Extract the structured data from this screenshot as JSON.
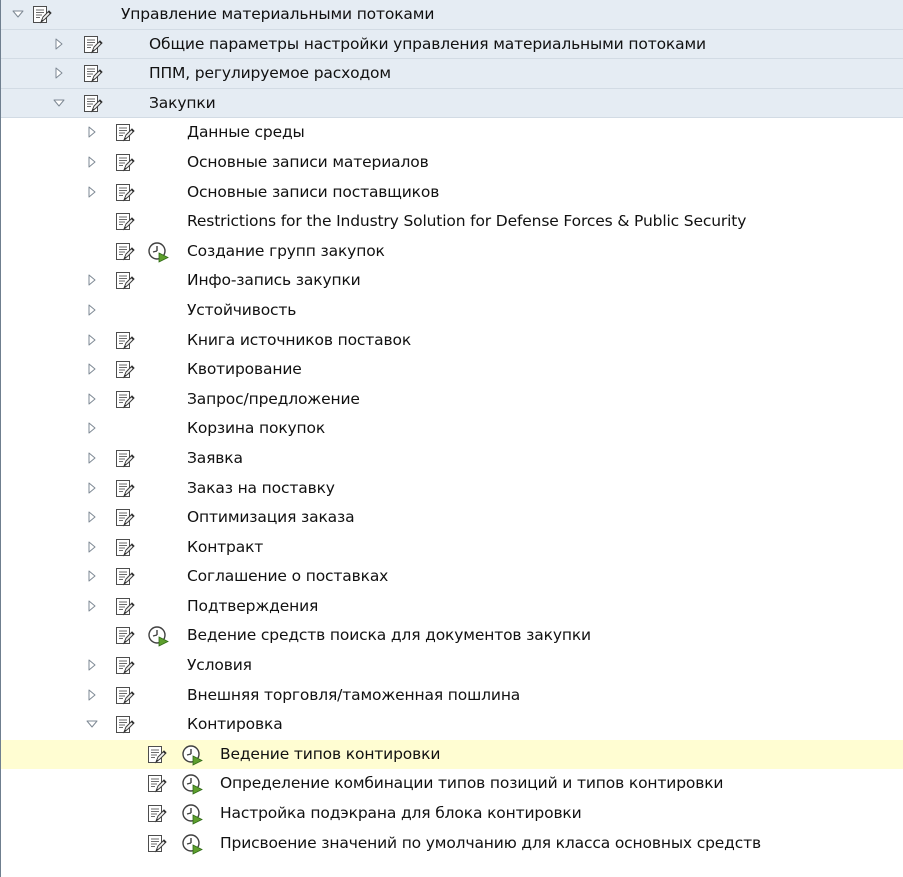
{
  "tree": {
    "items": [
      {
        "label": "Управление материальными потоками",
        "expander": "expanded",
        "doc": true,
        "exec": false,
        "bg": "bg",
        "level": 0
      },
      {
        "label": "Общие параметры настройки управления материальными потоками",
        "expander": "collapsed",
        "doc": true,
        "exec": false,
        "bg": "bg",
        "level": 1
      },
      {
        "label": "ППМ, регулируемое расходом",
        "expander": "collapsed",
        "doc": true,
        "exec": false,
        "bg": "bg",
        "level": 1
      },
      {
        "label": "Закупки",
        "expander": "expanded",
        "doc": true,
        "exec": false,
        "bg": "bg",
        "level": 1
      },
      {
        "label": "Данные среды",
        "expander": "collapsed",
        "doc": true,
        "exec": false,
        "bg": "white",
        "level": 2
      },
      {
        "label": "Основные записи материалов",
        "expander": "collapsed",
        "doc": true,
        "exec": false,
        "bg": "white",
        "level": 2
      },
      {
        "label": "Основные записи поставщиков",
        "expander": "collapsed",
        "doc": true,
        "exec": false,
        "bg": "white",
        "level": 2
      },
      {
        "label": "Restrictions for the Industry Solution for Defense Forces & Public Security",
        "expander": "none",
        "doc": true,
        "exec": false,
        "bg": "white",
        "level": 2
      },
      {
        "label": "Создание групп закупок",
        "expander": "none",
        "doc": true,
        "exec": true,
        "bg": "white",
        "level": 2
      },
      {
        "label": "Инфо-запись закупки",
        "expander": "collapsed",
        "doc": true,
        "exec": false,
        "bg": "white",
        "level": 2
      },
      {
        "label": "Устойчивость",
        "expander": "collapsed",
        "doc": false,
        "exec": false,
        "bg": "white",
        "level": 2
      },
      {
        "label": "Книга источников поставок",
        "expander": "collapsed",
        "doc": true,
        "exec": false,
        "bg": "white",
        "level": 2
      },
      {
        "label": "Квотирование",
        "expander": "collapsed",
        "doc": true,
        "exec": false,
        "bg": "white",
        "level": 2
      },
      {
        "label": "Запрос/предложение",
        "expander": "collapsed",
        "doc": true,
        "exec": false,
        "bg": "white",
        "level": 2
      },
      {
        "label": "Корзина покупок",
        "expander": "collapsed",
        "doc": false,
        "exec": false,
        "bg": "white",
        "level": 2
      },
      {
        "label": "Заявка",
        "expander": "collapsed",
        "doc": true,
        "exec": false,
        "bg": "white",
        "level": 2
      },
      {
        "label": "Заказ на поставку",
        "expander": "collapsed",
        "doc": true,
        "exec": false,
        "bg": "white",
        "level": 2
      },
      {
        "label": "Оптимизация заказа",
        "expander": "collapsed",
        "doc": true,
        "exec": false,
        "bg": "white",
        "level": 2
      },
      {
        "label": "Контракт",
        "expander": "collapsed",
        "doc": true,
        "exec": false,
        "bg": "white",
        "level": 2
      },
      {
        "label": "Соглашение о поставках",
        "expander": "collapsed",
        "doc": true,
        "exec": false,
        "bg": "white",
        "level": 2
      },
      {
        "label": "Подтверждения",
        "expander": "collapsed",
        "doc": true,
        "exec": false,
        "bg": "white",
        "level": 2
      },
      {
        "label": "Ведение средств поиска для документов закупки",
        "expander": "none",
        "doc": true,
        "exec": true,
        "bg": "white",
        "level": 2
      },
      {
        "label": "Условия",
        "expander": "collapsed",
        "doc": true,
        "exec": false,
        "bg": "white",
        "level": 2
      },
      {
        "label": "Внешняя торговля/таможенная пошлина",
        "expander": "collapsed",
        "doc": true,
        "exec": false,
        "bg": "white",
        "level": 2
      },
      {
        "label": "Контировка",
        "expander": "expanded",
        "doc": true,
        "exec": false,
        "bg": "white",
        "level": 2
      },
      {
        "label": "Ведение типов контировки",
        "expander": "none",
        "doc": true,
        "exec": true,
        "bg": "selected",
        "level": 3
      },
      {
        "label": "Определение комбинации типов позиций и типов контировки",
        "expander": "none",
        "doc": true,
        "exec": true,
        "bg": "white",
        "level": 3
      },
      {
        "label": "Настройка подэкрана для блока контировки",
        "expander": "none",
        "doc": true,
        "exec": true,
        "bg": "white",
        "level": 3
      },
      {
        "label": "Присвоение значений по умолчанию для класса основных средств",
        "expander": "none",
        "doc": true,
        "exec": true,
        "bg": "white",
        "level": 3
      }
    ]
  },
  "icons": {
    "expander_expanded": "triangle-down-icon",
    "expander_collapsed": "triangle-right-icon",
    "documentation": "documentation-icon",
    "execute": "clock-execute-icon"
  },
  "colors": {
    "header_bg": "#e5ecf3",
    "selected_bg": "#fffdd2",
    "triangle_stroke": "#8a96a3",
    "exec_green": "#5e9f2d"
  }
}
